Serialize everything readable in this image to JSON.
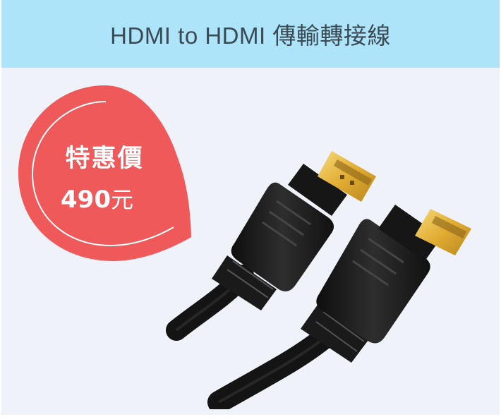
{
  "title": "HDMI to HDMI 傳輸轉接線",
  "badge": {
    "label": "特惠價",
    "price": "490",
    "unit": "元"
  },
  "colors": {
    "header_bg": "#ade4f9",
    "body_bg": "#f0f2fa",
    "badge": "#f0595a",
    "cable": "#1c1c1c",
    "connector": "#e6b33a"
  },
  "product_icon": "hdmi-cable-image"
}
